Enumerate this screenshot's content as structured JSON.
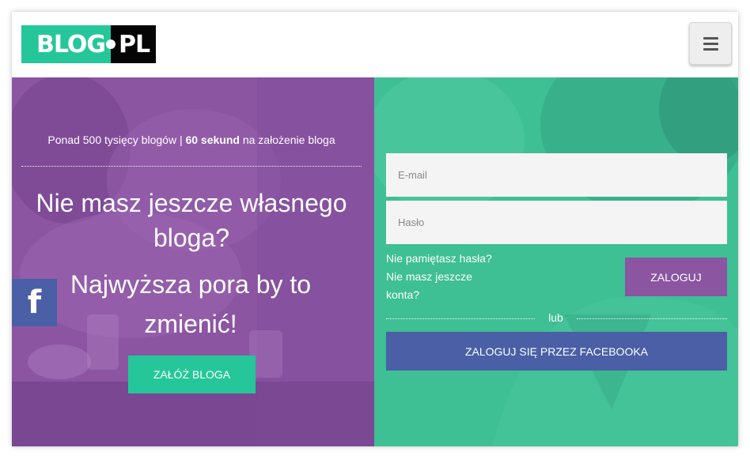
{
  "header": {
    "logo_left": "BLOG",
    "logo_right": "PL",
    "menu_icon": "hamburger-icon"
  },
  "left": {
    "tagline_part1": "Ponad 500 tysięcy blogów | ",
    "tagline_bold": "60 sekund",
    "tagline_part2": " na założenie bloga",
    "headline_line1": "Nie masz jeszcze własnego",
    "headline_line2": "bloga?",
    "headline_bold_line1": "Najwyższa pora by to",
    "headline_bold_line2": "zmienić!",
    "create_button": "ZAŁÓŻ BLOGA",
    "facebook_side_icon": "facebook-icon",
    "facebook_side_glyph": "f"
  },
  "login": {
    "email_placeholder": "E-mail",
    "password_placeholder": "Hasło",
    "forgot_password": "Nie pamiętasz hasła?",
    "no_account_line1": "Nie masz jeszcze",
    "no_account_line2": "konta?",
    "login_button": "ZALOGUJ",
    "or_text": "lub",
    "facebook_login": "ZALOGUJ SIĘ PRZEZ FACEBOOKA"
  },
  "colors": {
    "brand_green": "#25c79a",
    "purple": "#8b55a2",
    "facebook_blue": "#4a5fa5",
    "logo_black": "#050505"
  }
}
